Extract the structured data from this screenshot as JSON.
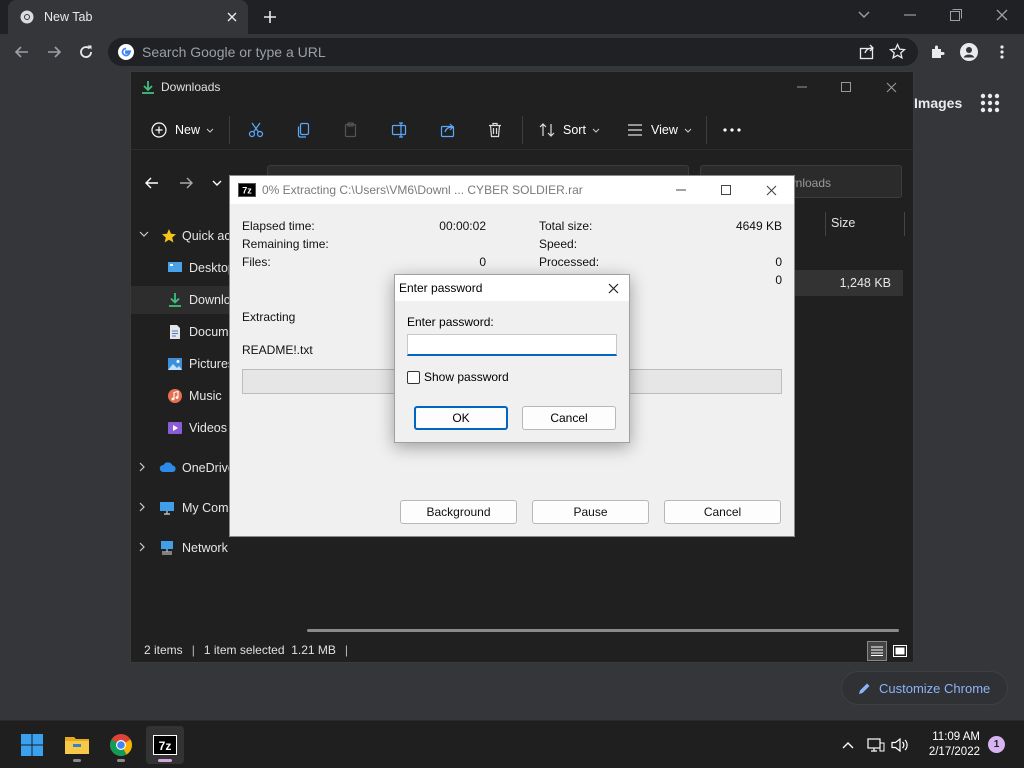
{
  "chrome": {
    "tab_title": "New Tab",
    "omnibox_placeholder": "Search Google or type a URL",
    "images_link": "Images",
    "customize_label": "Customize Chrome"
  },
  "explorer": {
    "title": "Downloads",
    "commands": {
      "new": "New",
      "sort": "Sort",
      "view": "View"
    },
    "search_placeholder": "Search Downloads",
    "search_visible": "wnloads",
    "nav": [
      {
        "label": "Quick access"
      },
      {
        "label": "Desktop"
      },
      {
        "label": "Downloads"
      },
      {
        "label": "Documents"
      },
      {
        "label": "Pictures"
      },
      {
        "label": "Music"
      },
      {
        "label": "Videos"
      },
      {
        "label": "OneDrive"
      },
      {
        "label": "My Computer"
      },
      {
        "label": "Network"
      }
    ],
    "nav_visible": [
      "Quick acc",
      "Desktop",
      "Downlo",
      "Docum",
      "Pictures",
      "Music",
      "Videos",
      "OneDrive",
      "My Comp",
      "Network"
    ],
    "column_size": "Size",
    "row_size": "1,248 KB",
    "status": {
      "items": "2 items",
      "selected": "1 item selected  1.21 MB"
    }
  },
  "extract": {
    "title": "0% Extracting C:\\Users\\VM6\\Downl ...  CYBER SOLDIER.rar",
    "elapsed_label": "Elapsed time:",
    "elapsed_value": "00:00:02",
    "remaining_label": "Remaining time:",
    "files_label": "Files:",
    "files_value": "0",
    "total_size_label": "Total size:",
    "total_size_value": "4649 KB",
    "speed_label": "Speed:",
    "processed_label": "Processed:",
    "processed_value": "0",
    "packed_value": "0",
    "action": "Extracting",
    "current_file": "README!.txt",
    "progress": 0,
    "buttons": {
      "background": "Background",
      "pause": "Pause",
      "cancel": "Cancel"
    }
  },
  "password_dialog": {
    "title": "Enter password",
    "label": "Enter password:",
    "value": "",
    "show_password_label": "Show password",
    "ok": "OK",
    "cancel": "Cancel"
  },
  "taskbar": {
    "time": "11:09 AM",
    "date": "2/17/2022",
    "notification_count": "1"
  },
  "colors": {
    "chrome_dark": "#202124",
    "explorer_bg": "#202020",
    "dialog_bg": "#f0f0f0",
    "accent": "#0067c0",
    "link_blue": "#8ab4f8"
  },
  "icons": [
    "chrome-icon",
    "close-icon",
    "plus-icon",
    "back-icon",
    "forward-icon",
    "reload-icon",
    "google-icon",
    "share-icon",
    "star-icon",
    "extensions-icon",
    "profile-icon",
    "menu-icon",
    "apps-grid-icon",
    "pencil-icon",
    "download-icon",
    "cut-icon",
    "copy-icon",
    "paste-icon",
    "rename-icon",
    "share-icon",
    "delete-icon",
    "sort-icon",
    "view-icon",
    "more-icon",
    "star-icon",
    "desktop-icon",
    "documents-icon",
    "pictures-icon",
    "music-icon",
    "videos-icon",
    "cloud-icon",
    "computer-icon",
    "network-icon",
    "7zip-icon",
    "windows-icon",
    "folder-icon",
    "wifi-icon",
    "volume-icon"
  ]
}
